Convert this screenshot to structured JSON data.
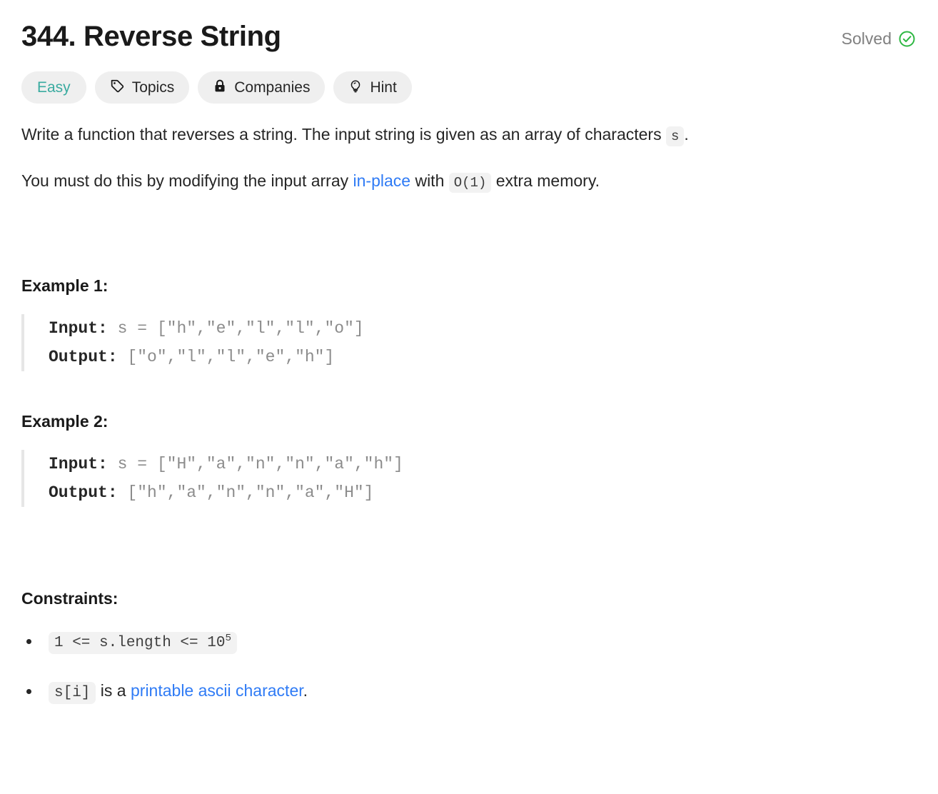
{
  "header": {
    "title": "344. Reverse String",
    "status_label": "Solved",
    "status_icon": "check-circle-icon",
    "status_color": "#2db742"
  },
  "pills": [
    {
      "label": "Easy",
      "icon": null,
      "color": "#3aaba0"
    },
    {
      "label": "Topics",
      "icon": "tag-icon",
      "color": "#262626"
    },
    {
      "label": "Companies",
      "icon": "lock-icon",
      "color": "#262626"
    },
    {
      "label": "Hint",
      "icon": "bulb-icon",
      "color": "#262626"
    }
  ],
  "description": {
    "p1_before": "Write a function that reverses a string. The input string is given as an array of characters ",
    "p1_code": "s",
    "p1_after": ".",
    "p2_before": "You must do this by modifying the input array ",
    "p2_link": "in-place",
    "p2_mid": " with ",
    "p2_code": "O(1)",
    "p2_after": " extra memory."
  },
  "examples": [
    {
      "heading": "Example 1:",
      "input_label": "Input:",
      "input_value": " s = [\"h\",\"e\",\"l\",\"l\",\"o\"]",
      "output_label": "Output:",
      "output_value": " [\"o\",\"l\",\"l\",\"e\",\"h\"]"
    },
    {
      "heading": "Example 2:",
      "input_label": "Input:",
      "input_value": " s = [\"H\",\"a\",\"n\",\"n\",\"a\",\"h\"]",
      "output_label": "Output:",
      "output_value": " [\"h\",\"a\",\"n\",\"n\",\"a\",\"H\"]"
    }
  ],
  "constraints": {
    "heading": "Constraints:",
    "item1_code_base": "1 <= s.length <= 10",
    "item1_code_sup": "5",
    "item2_code": "s[i]",
    "item2_text_before": " is a ",
    "item2_link": "printable ascii character",
    "item2_text_after": "."
  },
  "colors": {
    "link": "#2f7bf5",
    "difficulty_easy": "#3aaba0",
    "chip_bg": "#f2f2f2",
    "pill_bg": "#efefef",
    "solved_green": "#2db742"
  }
}
